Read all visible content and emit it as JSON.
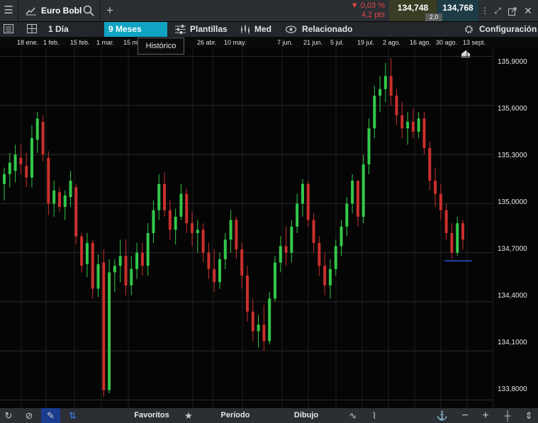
{
  "header": {
    "title": "Euro Bobl",
    "change_pct": "▼ 0,03 %",
    "change_pts": "4,2 pts",
    "bid": "134,748",
    "ask": "134,768",
    "spread": "2,0"
  },
  "toolbar": {
    "interval": "1 Día",
    "range": "9 Meses",
    "templates": "Plantillas",
    "indicator": "Med",
    "related": "Relacionado",
    "settings": "Configuración"
  },
  "tooltip": "Histórico",
  "dates": [
    "18 ene.",
    "1 feb.",
    "15 feb.",
    "1 mar.",
    "15 m",
    "26 abr.",
    "10 may.",
    "7 jun.",
    "21 jun.",
    "5 jul.",
    "19 jul.",
    "2 ago.",
    "16 ago.",
    "30 ago.",
    "13 sept."
  ],
  "y_labels": [
    "135,9000",
    "135,6000",
    "135,3000",
    "135,0000",
    "134,7000",
    "134,4000",
    "134,1000",
    "133,8000"
  ],
  "bottom": {
    "favorites": "Favoritos",
    "period": "Período",
    "drawing": "Dibujo"
  },
  "colors": {
    "up": "#33c94a",
    "down": "#c9302c",
    "line": "#2f4fd6"
  },
  "chart_data": {
    "type": "candlestick",
    "ylim": [
      133.75,
      135.95
    ],
    "candles": [
      [
        135.12,
        135.22,
        135.02,
        135.18
      ],
      [
        135.18,
        135.31,
        135.1,
        135.25
      ],
      [
        135.2,
        135.36,
        135.13,
        135.3
      ],
      [
        135.28,
        135.36,
        135.18,
        135.24
      ],
      [
        135.23,
        135.31,
        135.1,
        135.16
      ],
      [
        135.16,
        135.48,
        135.1,
        135.4
      ],
      [
        135.39,
        135.56,
        135.31,
        135.52
      ],
      [
        135.5,
        135.54,
        135.26,
        135.3
      ],
      [
        135.28,
        135.32,
        134.93,
        135.0
      ],
      [
        135.0,
        135.14,
        134.92,
        135.08
      ],
      [
        135.07,
        135.1,
        134.95,
        134.98
      ],
      [
        134.98,
        135.08,
        134.9,
        135.05
      ],
      [
        135.04,
        135.2,
        134.98,
        135.14
      ],
      [
        135.1,
        135.12,
        134.75,
        134.8
      ],
      [
        134.8,
        134.82,
        134.58,
        134.62
      ],
      [
        134.63,
        134.82,
        134.55,
        134.76
      ],
      [
        134.76,
        134.78,
        134.42,
        134.48
      ],
      [
        134.48,
        134.69,
        134.43,
        134.63
      ],
      [
        134.64,
        134.72,
        133.82,
        133.86
      ],
      [
        133.86,
        134.66,
        133.84,
        134.58
      ],
      [
        134.58,
        134.66,
        134.46,
        134.62
      ],
      [
        134.62,
        134.78,
        134.52,
        134.68
      ],
      [
        134.68,
        134.78,
        134.44,
        134.5
      ],
      [
        134.5,
        134.68,
        134.44,
        134.6
      ],
      [
        134.6,
        134.76,
        134.54,
        134.7
      ],
      [
        134.7,
        134.76,
        134.56,
        134.62
      ],
      [
        134.62,
        134.88,
        134.56,
        134.82
      ],
      [
        134.82,
        135.02,
        134.76,
        134.96
      ],
      [
        134.96,
        135.18,
        134.9,
        135.12
      ],
      [
        135.12,
        135.19,
        134.92,
        134.96
      ],
      [
        134.96,
        135.02,
        134.78,
        134.84
      ],
      [
        134.84,
        134.97,
        134.75,
        134.92
      ],
      [
        134.92,
        135.12,
        134.9,
        135.06
      ],
      [
        135.06,
        135.09,
        134.82,
        134.88
      ],
      [
        134.88,
        134.95,
        134.74,
        134.82
      ],
      [
        134.82,
        134.9,
        134.7,
        134.84
      ],
      [
        134.84,
        134.88,
        134.64,
        134.7
      ],
      [
        134.7,
        134.76,
        134.54,
        134.6
      ],
      [
        134.6,
        134.72,
        134.46,
        134.52
      ],
      [
        134.52,
        134.7,
        134.48,
        134.66
      ],
      [
        134.66,
        134.82,
        134.6,
        134.78
      ],
      [
        134.78,
        134.96,
        134.7,
        134.9
      ],
      [
        134.9,
        134.92,
        134.66,
        134.72
      ],
      [
        134.72,
        134.76,
        134.48,
        134.56
      ],
      [
        134.56,
        134.62,
        134.28,
        134.34
      ],
      [
        134.34,
        134.42,
        134.16,
        134.22
      ],
      [
        134.22,
        134.32,
        134.12,
        134.26
      ],
      [
        134.26,
        134.38,
        134.1,
        134.16
      ],
      [
        134.16,
        134.46,
        134.14,
        134.42
      ],
      [
        134.42,
        134.68,
        134.4,
        134.64
      ],
      [
        134.64,
        134.8,
        134.58,
        134.74
      ],
      [
        134.74,
        134.86,
        134.62,
        134.7
      ],
      [
        134.7,
        134.9,
        134.64,
        134.86
      ],
      [
        134.86,
        135.06,
        134.82,
        135.0
      ],
      [
        135.0,
        135.15,
        134.92,
        135.12
      ],
      [
        135.12,
        135.14,
        134.86,
        134.9
      ],
      [
        134.9,
        134.94,
        134.7,
        134.76
      ],
      [
        134.76,
        134.8,
        134.56,
        134.62
      ],
      [
        134.62,
        134.7,
        134.44,
        134.5
      ],
      [
        134.5,
        134.66,
        134.42,
        134.6
      ],
      [
        134.6,
        134.78,
        134.56,
        134.74
      ],
      [
        134.74,
        134.9,
        134.68,
        134.86
      ],
      [
        134.86,
        135.04,
        134.8,
        135.0
      ],
      [
        135.0,
        135.18,
        134.94,
        135.14
      ],
      [
        135.14,
        135.08,
        134.86,
        134.92
      ],
      [
        134.92,
        135.3,
        134.88,
        135.24
      ],
      [
        135.24,
        135.52,
        135.18,
        135.46
      ],
      [
        135.46,
        135.72,
        135.4,
        135.66
      ],
      [
        135.66,
        135.78,
        135.56,
        135.7
      ],
      [
        135.7,
        135.86,
        135.62,
        135.78
      ],
      [
        135.78,
        135.89,
        135.6,
        135.66
      ],
      [
        135.66,
        135.7,
        135.48,
        135.54
      ],
      [
        135.54,
        135.62,
        135.4,
        135.46
      ],
      [
        135.46,
        135.56,
        135.36,
        135.5
      ],
      [
        135.5,
        135.58,
        135.4,
        135.44
      ],
      [
        135.44,
        135.56,
        135.4,
        135.52
      ],
      [
        135.52,
        135.56,
        135.3,
        135.34
      ],
      [
        135.34,
        135.38,
        135.08,
        135.14
      ],
      [
        135.14,
        135.22,
        134.98,
        135.06
      ],
      [
        135.06,
        135.12,
        134.9,
        134.96
      ],
      [
        134.96,
        135.0,
        134.78,
        134.82
      ],
      [
        134.82,
        134.88,
        134.66,
        134.7
      ],
      [
        134.7,
        134.92,
        134.68,
        134.88
      ],
      [
        134.88,
        134.9,
        134.72,
        134.78
      ]
    ],
    "reference_line": 134.65
  }
}
